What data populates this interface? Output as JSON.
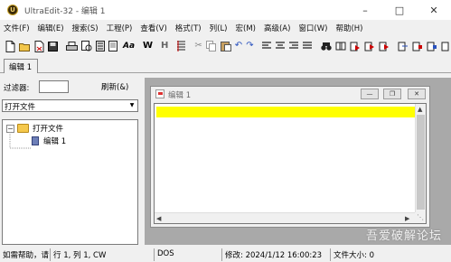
{
  "window": {
    "title": "UltraEdit-32 - 编辑 1",
    "app_icon_letter": "U"
  },
  "menu": [
    {
      "label": "文件(F)"
    },
    {
      "label": "编辑(E)"
    },
    {
      "label": "搜索(S)"
    },
    {
      "label": "工程(P)"
    },
    {
      "label": "查看(V)"
    },
    {
      "label": "格式(T)"
    },
    {
      "label": "列(L)"
    },
    {
      "label": "宏(M)"
    },
    {
      "label": "高级(A)"
    },
    {
      "label": "窗口(W)"
    },
    {
      "label": "帮助(H)"
    }
  ],
  "tabs": [
    {
      "label": "编辑 1"
    }
  ],
  "left_panel": {
    "filter_label": "过滤器:",
    "filter_value": "",
    "refresh_label": "刷新(&)",
    "combo_value": "打开文件",
    "tree": {
      "root_label": "打开文件",
      "child_label": "编辑 1"
    }
  },
  "child_window": {
    "title": "编辑 1"
  },
  "status": {
    "help": "如需帮助，请",
    "position": "行 1, 列 1, CW",
    "format": "DOS",
    "modified": "修改: 2024/1/12 16:00:23",
    "filesize": "文件大小: 0"
  },
  "watermark": "吾爱破解论坛",
  "colors": {
    "current_line": "#ffff00",
    "mdi_background": "#a9a9a9"
  }
}
